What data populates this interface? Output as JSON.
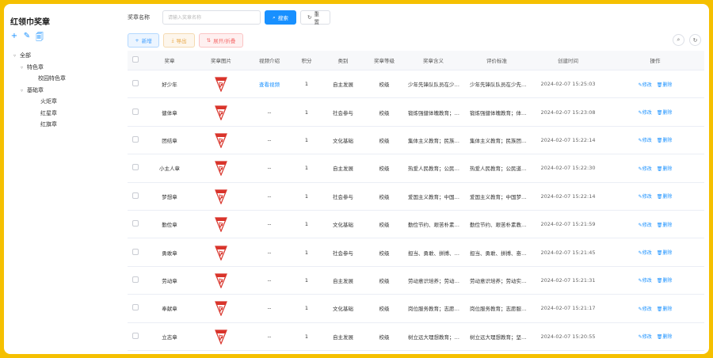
{
  "sidebar": {
    "title": "红领巾奖章",
    "tools": [
      "+",
      "✎",
      "🗐"
    ],
    "tree": [
      {
        "label": "全部",
        "level": "l0",
        "arrow": "▿"
      },
      {
        "label": "特色章",
        "level": "l1",
        "arrow": "▿"
      },
      {
        "label": "校园特色章",
        "level": "l2",
        "arrow": ""
      },
      {
        "label": "基础章",
        "level": "l1",
        "arrow": "▿"
      },
      {
        "label": "火炬章",
        "level": "l2b",
        "arrow": ""
      },
      {
        "label": "红星章",
        "level": "l2b",
        "arrow": ""
      },
      {
        "label": "红旗章",
        "level": "l2b",
        "arrow": ""
      }
    ]
  },
  "search": {
    "label": "奖章名称",
    "placeholder": "请输入奖章名称",
    "search_button": "搜索",
    "reset_button": "重置"
  },
  "toolbar": {
    "add": "新增",
    "export": "导出",
    "collapse": "展开/折叠"
  },
  "table": {
    "headers": [
      "奖章",
      "奖章图片",
      "视频介绍",
      "积分",
      "类别",
      "奖章等级",
      "奖章含义",
      "评价标准",
      "创建时间",
      "操作"
    ],
    "rows": [
      {
        "name": "好少年",
        "video": "查看视频",
        "score": "1",
        "category": "自主发展",
        "level": "校级",
        "meaning": "少年先锋队队员在少先队组织中...",
        "standard": "少年先锋队队员在少先队组织中...",
        "time": "2024-02-07 15:25:03"
      },
      {
        "name": "健体章",
        "video": "--",
        "score": "1",
        "category": "社会参与",
        "level": "校级",
        "meaning": "锻炼强健体魄教育；体质健康...",
        "standard": "锻炼强健体魄教育；体质健康...",
        "time": "2024-02-07 15:23:08"
      },
      {
        "name": "团结章",
        "video": "--",
        "score": "1",
        "category": "文化基础",
        "level": "校级",
        "meaning": "集体主义教育；民族团结教育...",
        "standard": "集体主义教育；民族团结教育...",
        "time": "2024-02-07 15:22:14"
      },
      {
        "name": "小主人章",
        "video": "--",
        "score": "1",
        "category": "自主发展",
        "level": "校级",
        "meaning": "热爱人民教育；公民道德教育...",
        "standard": "热爱人民教育；公民道德教育...",
        "time": "2024-02-07 15:22:30"
      },
      {
        "name": "梦想章",
        "video": "--",
        "score": "1",
        "category": "社会参与",
        "level": "校级",
        "meaning": "爱国主义教育；中国梦教育...",
        "standard": "爱国主义教育；中国梦教育...",
        "time": "2024-02-07 15:22:14"
      },
      {
        "name": "勤俭章",
        "video": "--",
        "score": "1",
        "category": "文化基础",
        "level": "校级",
        "meaning": "勤俭节约、艰苦朴素教育...",
        "standard": "勤俭节约、艰苦朴素教育...",
        "time": "2024-02-07 15:21:59"
      },
      {
        "name": "勇敢章",
        "video": "--",
        "score": "1",
        "category": "社会参与",
        "level": "校级",
        "meaning": "担当、勇敢、拼搏、奋斗...",
        "standard": "担当、勇敢、拼搏、奋斗...",
        "time": "2024-02-07 15:21:45"
      },
      {
        "name": "劳动章",
        "video": "--",
        "score": "1",
        "category": "自主发展",
        "level": "校级",
        "meaning": "劳动意识培养；劳动实践...",
        "standard": "劳动意识培养；劳动实践...",
        "time": "2024-02-07 15:21:31"
      },
      {
        "name": "奉献章",
        "video": "--",
        "score": "1",
        "category": "文化基础",
        "level": "校级",
        "meaning": "岗位服务教育；志愿服务教育...",
        "standard": "岗位服务教育；志愿服务教育...",
        "time": "2024-02-07 15:21:17"
      },
      {
        "name": "立志章",
        "video": "--",
        "score": "1",
        "category": "自主发展",
        "level": "校级",
        "meaning": "树立远大理想教育；坚定信念...",
        "standard": "树立远大理想教育；坚定信念...",
        "time": "2024-02-07 15:20:55"
      }
    ],
    "edit_label": "修改",
    "delete_label": "删除"
  },
  "colors": {
    "frame_border": "#f5c000",
    "primary": "#1890ff",
    "badge_red": "#d9342b"
  }
}
